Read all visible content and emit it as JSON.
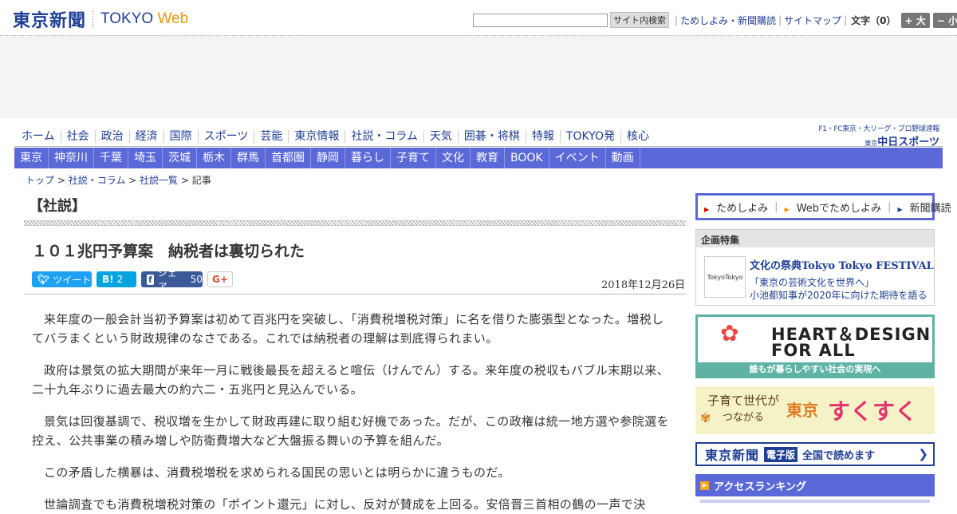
{
  "header": {
    "logo_main": "東京新聞",
    "logo_sub_a": "TOKYO ",
    "logo_sub_b": "Web",
    "search_button": "サイト内検索",
    "links": [
      "ためしよみ・新聞購読",
      "サイトマップ"
    ],
    "font_size_label": "文字（0）",
    "font_bigger": "+ 大",
    "font_smaller": "− 小"
  },
  "global_nav": [
    "ホーム",
    "社会",
    "政治",
    "経済",
    "国際",
    "スポーツ",
    "芸能",
    "東京情報",
    "社説・コラム",
    "天気",
    "囲碁・将棋",
    "特報",
    "TOKYO発",
    "核心"
  ],
  "chunichi": {
    "top": "F1・FC東京・大リーグ・プロ野球速報",
    "bottom_small": "東京",
    "bottom": "中日スポーツ"
  },
  "local_nav": [
    "東京",
    "神奈川",
    "千葉",
    "埼玉",
    "茨城",
    "栃木",
    "群馬",
    "首都圏",
    "静岡",
    "暮らし",
    "子育て",
    "文化",
    "教育",
    "BOOK",
    "イベント",
    "動画"
  ],
  "breadcrumb": {
    "items": [
      "トップ",
      "社説・コラム",
      "社説一覧"
    ],
    "current": "記事",
    "sep": " > "
  },
  "article": {
    "section": "【社説】",
    "title": "１０１兆円予算案　納税者は裏切られた",
    "date": "2018年12月26日",
    "share": {
      "tweet": "ツイート",
      "hatena_count": "2",
      "fb_label": "シェア",
      "fb_count": "50",
      "gplus": "G+"
    },
    "paragraphs": [
      "来年度の一般会計当初予算案は初めて百兆円を突破し、「消費税増税対策」に名を借りた膨張型となった。増税してバラまくという財政規律のなさである。これでは納税者の理解は到底得られまい。",
      "政府は景気の拡大期間が来年一月に戦後最長を超えると喧伝（けんでん）する。来年度の税収もバブル末期以来、二十九年ぶりに過去最大の約六二・五兆円と見込んでいる。",
      "景気は回復基調で、税収増を生かして財政再建に取り組む好機であった。だが、この政権は統一地方選や参院選を控え、公共事業の積み増しや防衛費増大など大盤振る舞いの予算を組んだ。",
      "この矛盾した横暴は、消費税増税を求められる国民の思いとは明らかに違うものだ。",
      "世論調査でも消費税増税対策の「ポイント還元」に対し、反対が賛成を上回る。安倍晋三首相の鶴の一声で決"
    ]
  },
  "sidebar": {
    "top_links": [
      "ためしよみ",
      "Webでためしよみ",
      "新聞購読"
    ],
    "kikaku": {
      "header": "企画特集",
      "thumb": "TokyoTokyo",
      "title": "文化の祭典Tokyo Tokyo FESTIVAL",
      "sub1": "「東京の芸術文化を世界へ」",
      "sub2": "小池都知事が2020年に向けた期待を語る"
    },
    "heart_design": {
      "line1": "HEART＆DESIGN",
      "line2": "FOR ALL",
      "bar": "誰もが暮らしやすい社会の実現へ"
    },
    "sukusuku": {
      "line1": "子育て世代が",
      "line2": "つながる",
      "tokyo": "東京",
      "brand": "すくすく"
    },
    "denshi": {
      "logo": "東京新聞",
      "tag": "電子版",
      "text": "全国で読めます"
    },
    "ranking": "アクセスランキング"
  }
}
